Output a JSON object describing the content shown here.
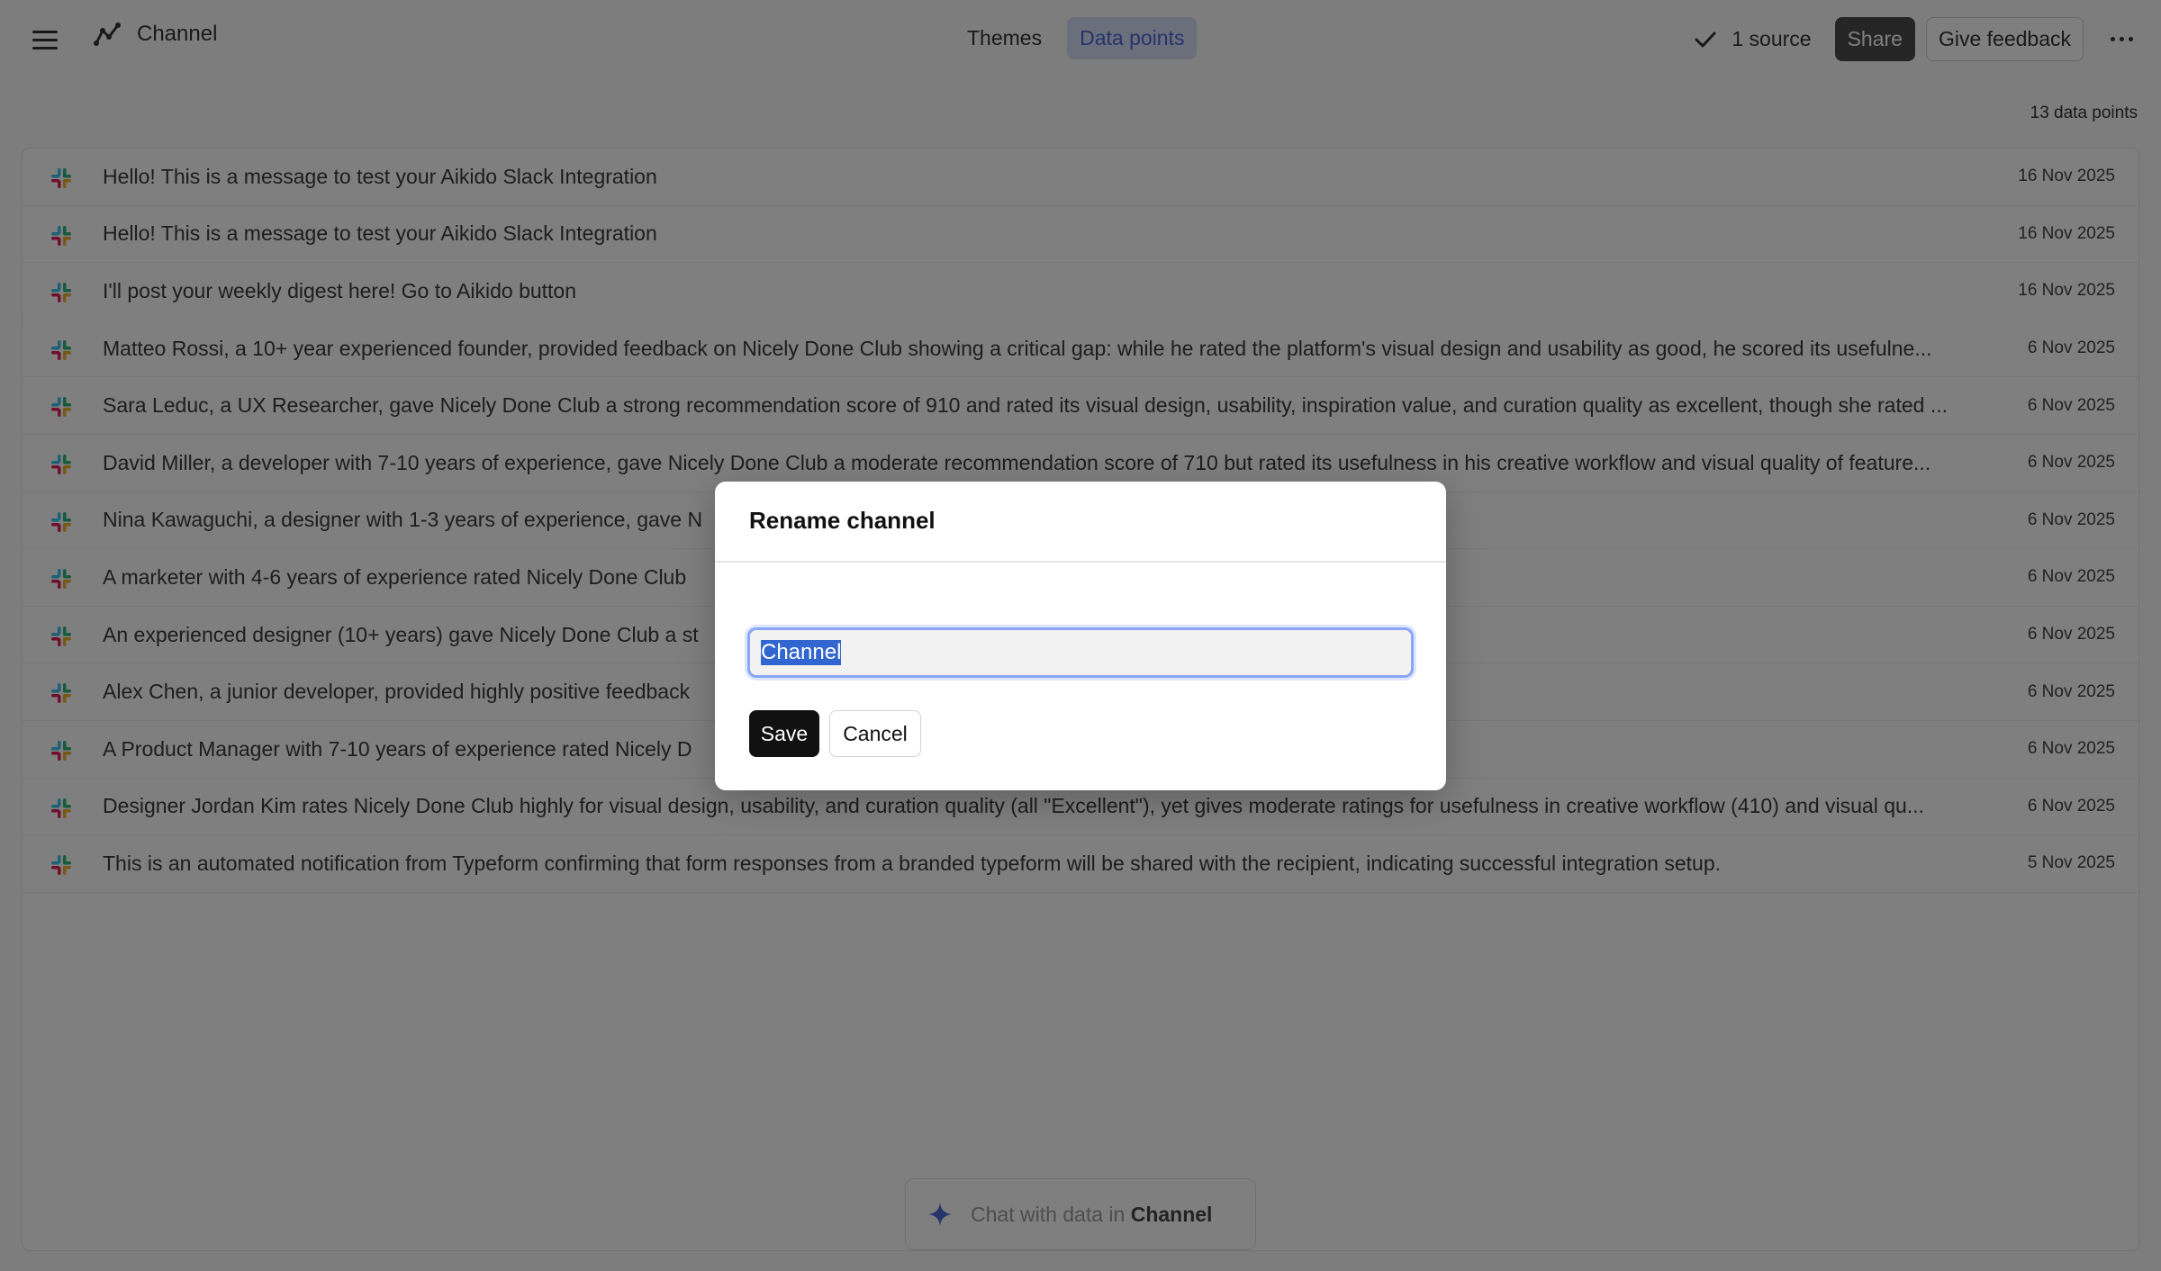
{
  "header": {
    "title": "Channel",
    "tabs": [
      {
        "label": "Themes",
        "active": false
      },
      {
        "label": "Data points",
        "active": true
      }
    ],
    "sources_label": "1 source",
    "share_label": "Share",
    "feedback_label": "Give feedback"
  },
  "count_label": "13 data points",
  "rows": [
    {
      "text": "Hello! This is a message to test your Aikido Slack Integration",
      "date": "16 Nov 2025"
    },
    {
      "text": "Hello! This is a message to test your Aikido Slack Integration",
      "date": "16 Nov 2025"
    },
    {
      "text": "I'll post your weekly digest here! Go to Aikido button",
      "date": "16 Nov 2025"
    },
    {
      "text": "Matteo Rossi, a 10+ year experienced founder, provided feedback on Nicely Done Club showing a critical gap: while he rated the platform's visual design and usability as good, he scored its usefulne...",
      "date": "6 Nov 2025"
    },
    {
      "text": "Sara Leduc, a UX Researcher, gave Nicely Done Club a strong recommendation score of 910 and rated its visual design, usability, inspiration value, and curation quality as excellent, though she rated ...",
      "date": "6 Nov 2025"
    },
    {
      "text": "David Miller, a developer with 7-10 years of experience, gave Nicely Done Club a moderate recommendation score of 710 but rated its usefulness in his creative workflow and visual quality of feature...",
      "date": "6 Nov 2025"
    },
    {
      "text": "Nina Kawaguchi, a designer with 1-3 years of experience, gave N",
      "date": "6 Nov 2025"
    },
    {
      "text": "A marketer with 4-6 years of experience rated Nicely Done Club",
      "date": "6 Nov 2025"
    },
    {
      "text": "An experienced designer (10+ years) gave Nicely Done Club a st",
      "date": "6 Nov 2025"
    },
    {
      "text": "Alex Chen, a junior developer, provided highly positive feedback",
      "date": "6 Nov 2025"
    },
    {
      "text": "A Product Manager with 7-10 years of experience rated Nicely D",
      "date": "6 Nov 2025"
    },
    {
      "text": "Designer Jordan Kim rates Nicely Done Club highly for visual design, usability, and curation quality (all \"Excellent\"), yet gives moderate ratings for usefulness in creative workflow (410) and visual qu...",
      "date": "6 Nov 2025"
    },
    {
      "text": "This is an automated notification from Typeform confirming that form responses from a branded typeform will be shared with the recipient, indicating successful integration setup.",
      "date": "5 Nov 2025"
    }
  ],
  "chat": {
    "prefix": "Chat with data in",
    "channel": "Channel"
  },
  "modal": {
    "title": "Rename channel",
    "input_value": "Channel",
    "save_label": "Save",
    "cancel_label": "Cancel"
  },
  "colors": {
    "accent": "#4a68d6",
    "accent_bg": "#d7dff6",
    "overlay": "#000000",
    "share_bg": "#4a4a4a",
    "save_bg": "#111111",
    "sparkle": "#4a68d6"
  },
  "icons": {
    "menu": "menu-icon",
    "brand": "trend-line-icon",
    "check": "check-icon",
    "more": "more-horizontal-icon",
    "row": "slack-icon",
    "chat": "sparkle-icon"
  }
}
